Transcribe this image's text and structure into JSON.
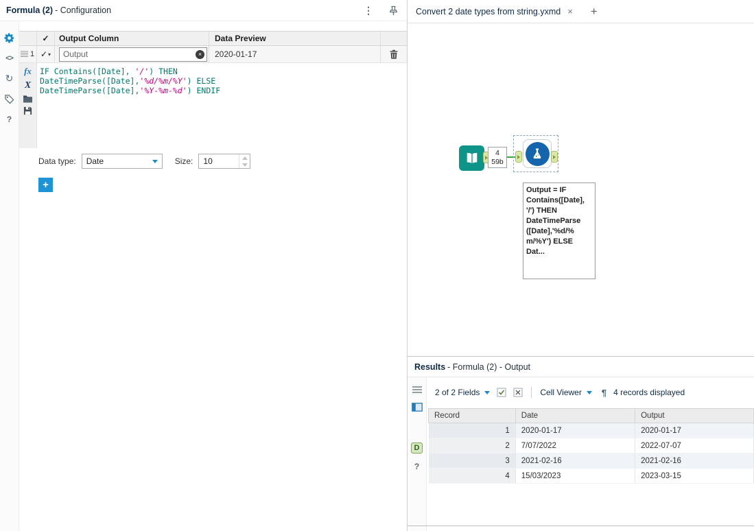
{
  "config": {
    "title": "Formula (2)",
    "title_suffix": " - Configuration",
    "columns": {
      "check": "✓",
      "output": "Output Column",
      "preview": "Data Preview"
    },
    "row": {
      "index": "1",
      "check": "✓",
      "output_value": "Output",
      "preview": "2020-01-17"
    },
    "formula": {
      "fx_label": "fx",
      "x_label": "X",
      "lines": [
        [
          {
            "t": "IF Contains([Date], ",
            "c": "code"
          },
          {
            "t": "'/'",
            "c": "str"
          },
          {
            "t": ") THEN",
            "c": "code"
          }
        ],
        [
          {
            "t": "DateTimeParse([Date],",
            "c": "code"
          },
          {
            "t": "'%d/%m/%Y'",
            "c": "str"
          },
          {
            "t": ") ELSE",
            "c": "code"
          }
        ],
        [
          {
            "t": "DateTimeParse([Date],",
            "c": "code"
          },
          {
            "t": "'%Y-%m-%d'",
            "c": "str"
          },
          {
            "t": ") ENDIF",
            "c": "code"
          }
        ]
      ]
    },
    "data_type_label": "Data type:",
    "data_type_value": "Date",
    "size_label": "Size:",
    "size_value": "10",
    "add_button": "+"
  },
  "tabs": {
    "active_title": "Convert 2 date types from string.yxmd",
    "close": "×",
    "new_tab": "+"
  },
  "canvas": {
    "connection_label_top": "4",
    "connection_label_bottom": "59b",
    "tooltip_lines": [
      "Output = IF",
      "Contains([Date],",
      "'/') THEN",
      "DateTimeParse",
      "([Date],'%d/%",
      "m/%Y') ELSE",
      "Dat..."
    ]
  },
  "results": {
    "title": "Results",
    "title_suffix": " - Formula (2) - Output",
    "fields_dropdown": "2 of 2 Fields",
    "cell_viewer": "Cell Viewer",
    "records_text": "4 records displayed",
    "table": {
      "headers": [
        "Record",
        "Date",
        "Output"
      ],
      "rows": [
        [
          "1",
          "2020-01-17",
          "2020-01-17"
        ],
        [
          "2",
          "7/07/2022",
          "2022-07-07"
        ],
        [
          "3",
          "2021-02-16",
          "2021-02-16"
        ],
        [
          "4",
          "15/03/2023",
          "2023-03-15"
        ]
      ]
    }
  },
  "icons": {
    "kebab": "⋮",
    "code_glyph": "<>",
    "refresh_glyph": "↻",
    "help_glyph": "?",
    "anchor_d": "D",
    "pilcrow": "¶",
    "clear": "×",
    "mini_caret": "▾"
  },
  "colors": {
    "accent_blue": "#1a8ac4",
    "code_teal": "#00786e",
    "code_string": "#c0007f",
    "tool_teal": "#0e9488",
    "tool_blue": "#1465ab",
    "connector_green": "#39a63c",
    "anchor_green": "#d9e7a8"
  }
}
